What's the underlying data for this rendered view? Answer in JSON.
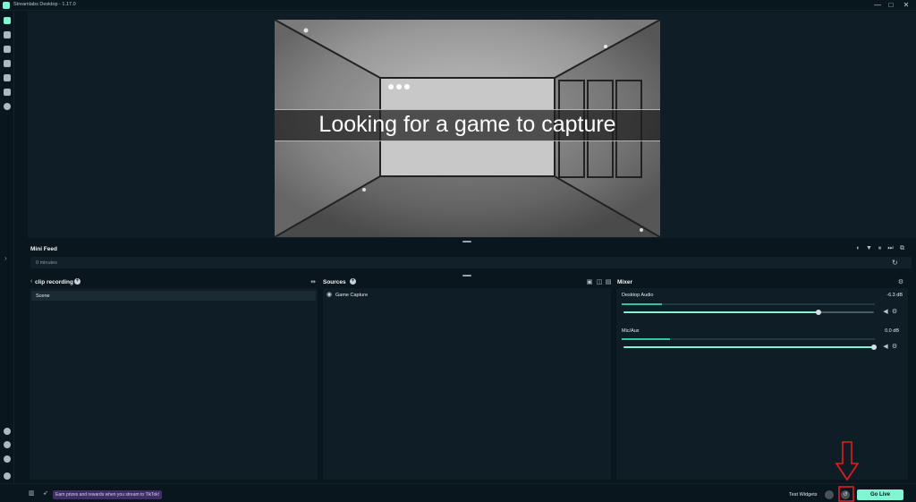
{
  "window": {
    "title": "Streamlabs Desktop - 1.17.0",
    "min_label": "—",
    "max_label": "□",
    "close_label": "✕"
  },
  "sidebar": {
    "icons": [
      "editor-icon",
      "layout-icon",
      "themes-icon",
      "tools-icon",
      "store-icon",
      "video-icon",
      "settings-icon"
    ],
    "bottom_icons": [
      "tiktok-icon",
      "tiktok-icon",
      "tiktok-icon",
      "help-icon",
      "user-icon"
    ]
  },
  "preview": {
    "message": "Looking for a game to capture"
  },
  "mini_feed": {
    "title": "Mini Feed",
    "status": "0 minutes"
  },
  "scenes": {
    "title": "clip recording",
    "items": [
      {
        "label": "Scene"
      }
    ]
  },
  "sources": {
    "title": "Sources",
    "items": [
      {
        "label": "Game Capture",
        "icon": "gamepad-icon"
      }
    ]
  },
  "mixer": {
    "title": "Mixer",
    "channels": [
      {
        "name": "Desktop Audio",
        "db": "-6.3 dB",
        "level": 0.78,
        "meter": 0.16
      },
      {
        "name": "Mic/Aux",
        "db": "0.0 dB",
        "level": 1.0,
        "meter": 0.19
      }
    ]
  },
  "footer": {
    "tiktok_promo": "Earn prizes and rewards when you stream to TikTok!",
    "test_widgets": "Test Widgets",
    "go_live": "Go Live"
  },
  "colors": {
    "accent": "#80f5d2",
    "background": "#09161d",
    "panel": "#0f1e26",
    "annotation": "#e01e1e"
  }
}
